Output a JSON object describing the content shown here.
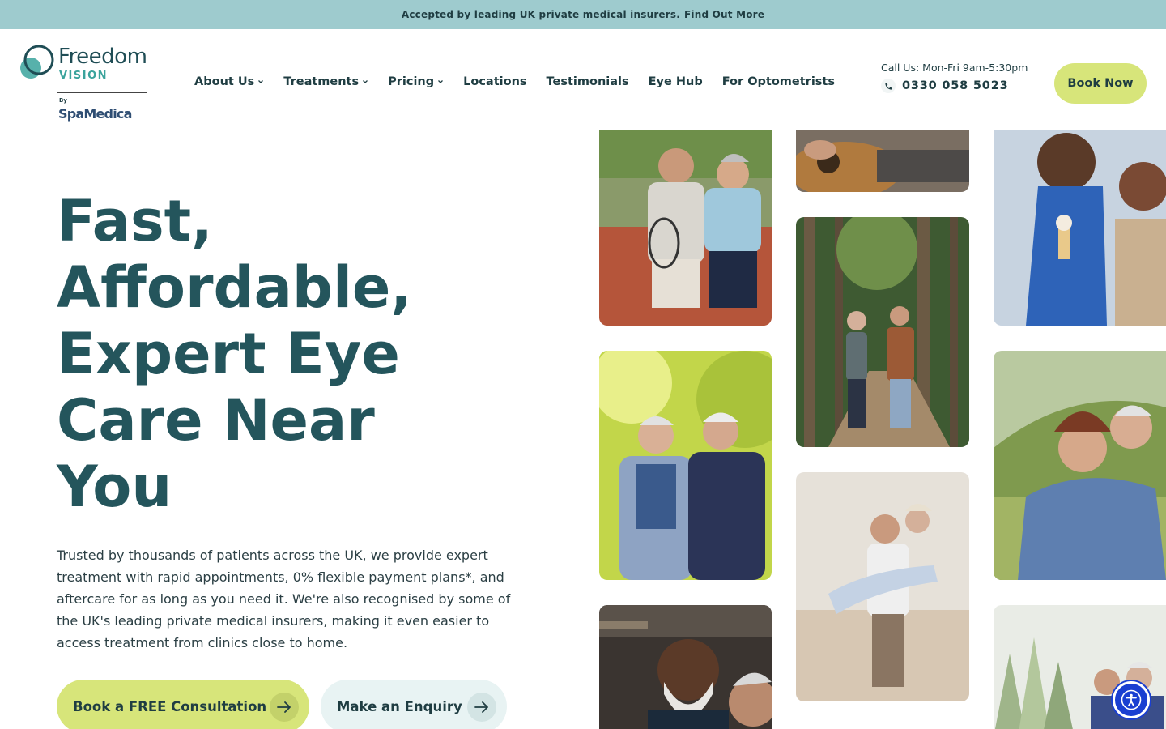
{
  "announcement": {
    "text": "Accepted by leading UK private medical insurers.",
    "link_label": "Find Out More"
  },
  "logo": {
    "line1": "Freedom",
    "line2": "VISION",
    "by": "By",
    "parent": "SpaMedica"
  },
  "nav": {
    "items": [
      {
        "label": "About Us",
        "has_dropdown": true
      },
      {
        "label": "Treatments",
        "has_dropdown": true
      },
      {
        "label": "Pricing",
        "has_dropdown": true
      },
      {
        "label": "Locations",
        "has_dropdown": false
      },
      {
        "label": "Testimonials",
        "has_dropdown": false
      },
      {
        "label": "Eye Hub",
        "has_dropdown": false
      },
      {
        "label": "For Optometrists",
        "has_dropdown": false
      }
    ]
  },
  "contact": {
    "label": "Call Us: Mon-Fri 9am-5:30pm",
    "phone": "0330 058 5023",
    "icon": "phone-icon"
  },
  "header": {
    "book_now_label": "Book Now"
  },
  "hero": {
    "title_lines": [
      "Fast,",
      "Affordable,",
      "Expert Eye",
      "Care Near",
      "You"
    ],
    "description": "Trusted by thousands of patients across the UK, we provide expert treatment with rapid appointments, 0% flexible payment plans*, and aftercare for as long as you need it. We're also recognised by some of the UK's leading private medical insurers, making it even easier to access treatment from clinics close to home.",
    "primary_cta": "Book a FREE Consultation",
    "secondary_cta": "Make an Enquiry",
    "cta_icon": "arrow-right-icon"
  },
  "photos": [
    {
      "name": "photo-tennis-couple"
    },
    {
      "name": "photo-guitar"
    },
    {
      "name": "photo-ice-cream-couple"
    },
    {
      "name": "photo-forest-walk"
    },
    {
      "name": "photo-two-friends"
    },
    {
      "name": "photo-beach-carry"
    },
    {
      "name": "photo-hug-field"
    },
    {
      "name": "photo-smiling-man"
    },
    {
      "name": "photo-grass-couple"
    }
  ],
  "colors": {
    "announce_bg": "#9ecbce",
    "heading": "#24555c",
    "accent_lime": "#d7e57a",
    "accent_mint": "#e8f3f3",
    "accessibility_blue": "#1a3fd1"
  },
  "accessibility": {
    "icon": "accessibility-icon"
  }
}
